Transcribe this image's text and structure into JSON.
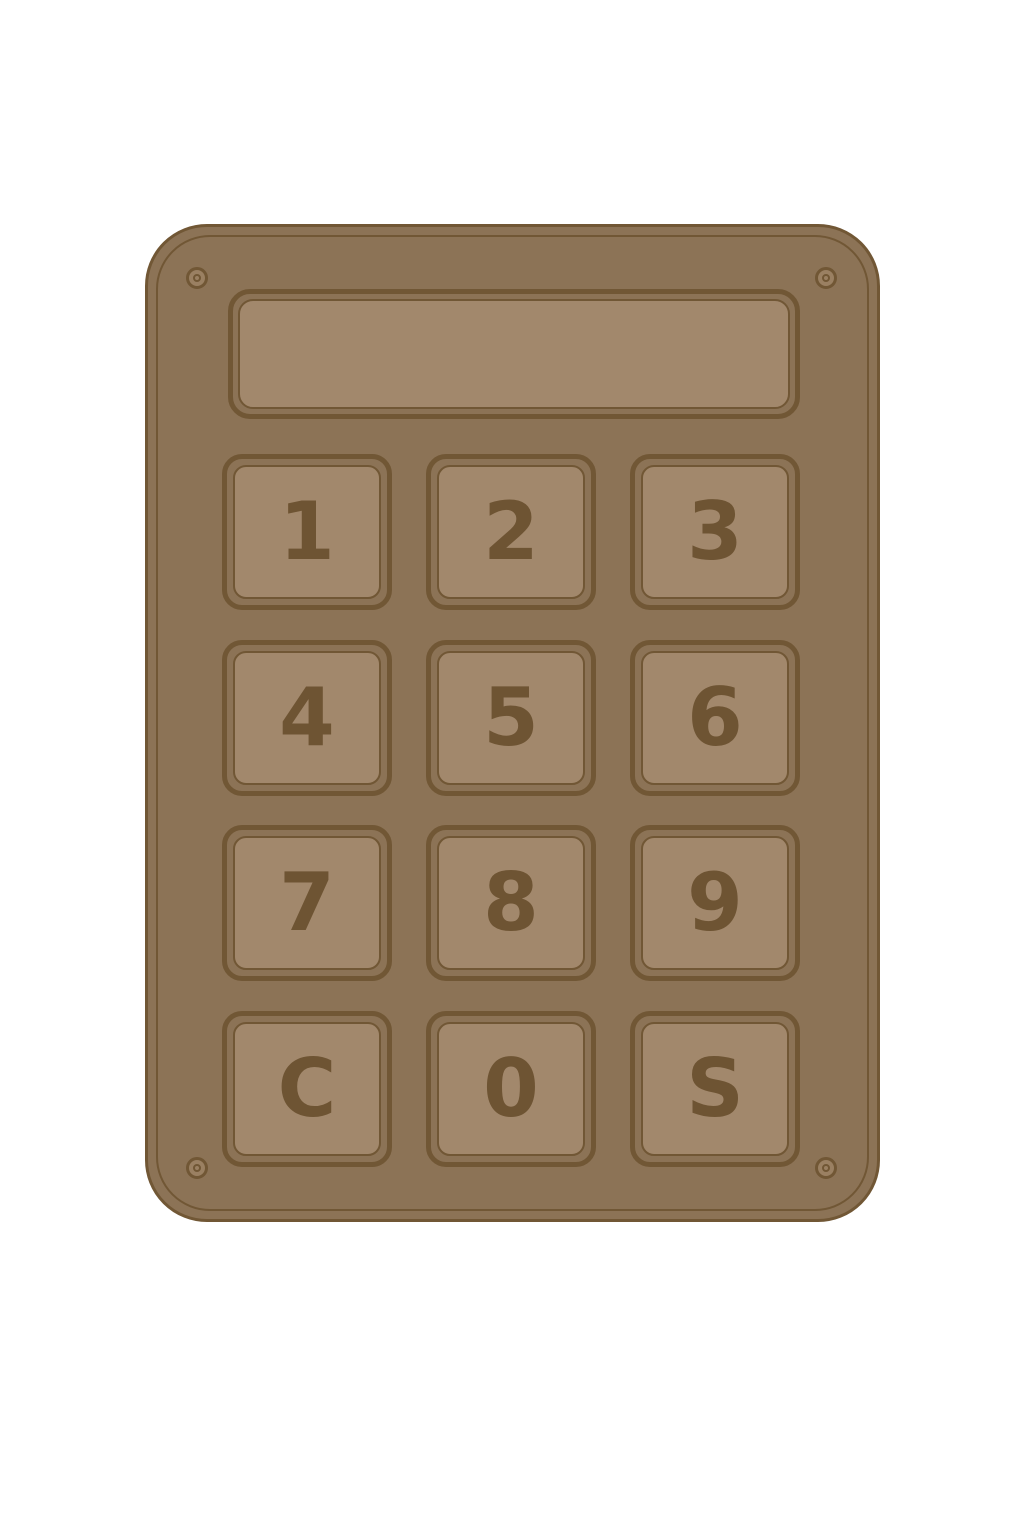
{
  "keypad": {
    "display_text": "",
    "keys": [
      {
        "label": "1",
        "name": "key-1"
      },
      {
        "label": "2",
        "name": "key-2"
      },
      {
        "label": "3",
        "name": "key-3"
      },
      {
        "label": "4",
        "name": "key-4"
      },
      {
        "label": "5",
        "name": "key-5"
      },
      {
        "label": "6",
        "name": "key-6"
      },
      {
        "label": "7",
        "name": "key-7"
      },
      {
        "label": "8",
        "name": "key-8"
      },
      {
        "label": "9",
        "name": "key-9"
      },
      {
        "label": "C",
        "name": "key-clear"
      },
      {
        "label": "0",
        "name": "key-0"
      },
      {
        "label": "S",
        "name": "key-submit"
      }
    ]
  },
  "colors": {
    "body": "#8c7356",
    "outline": "#715735",
    "key_face": "#a2886c",
    "label": "#6e5433"
  }
}
